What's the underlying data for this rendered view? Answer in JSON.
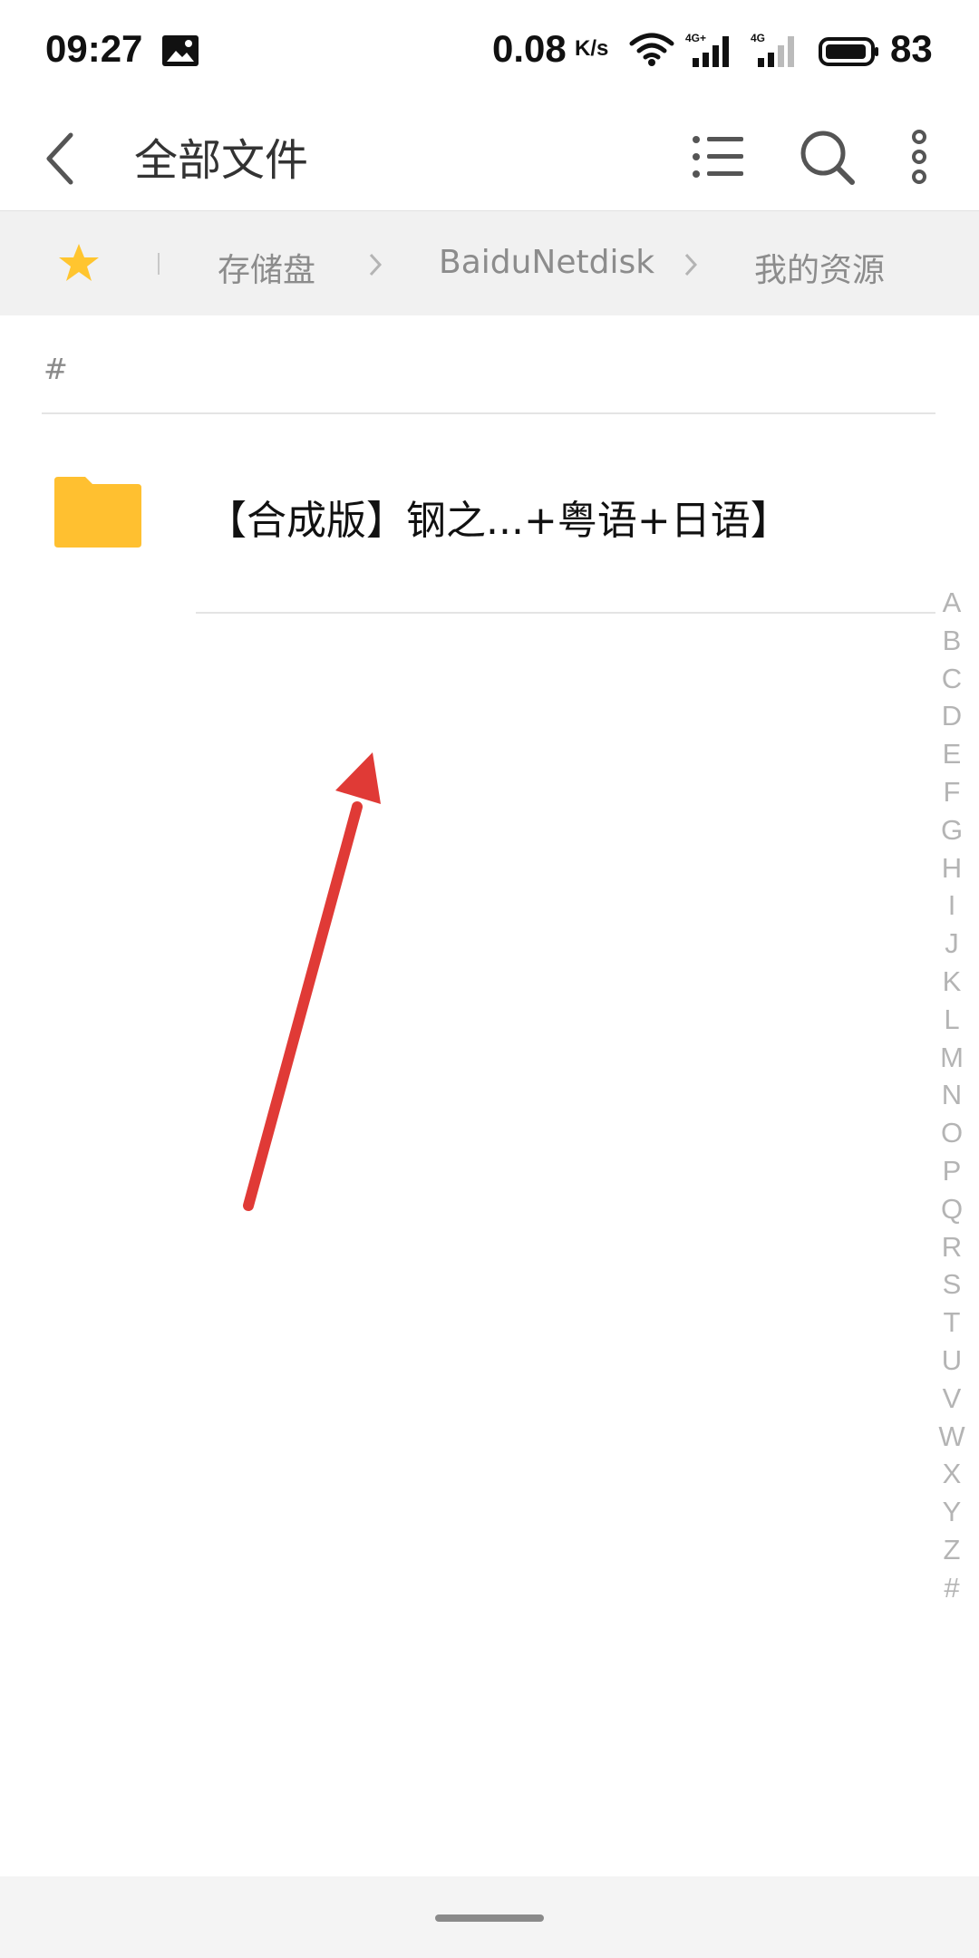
{
  "status_bar": {
    "time": "09:27",
    "net_speed": "0.08",
    "net_speed_unit": "K/s",
    "sim1_type": "4G+",
    "sim2_type": "4G",
    "battery": "83"
  },
  "app_bar": {
    "title": "全部文件",
    "icons": [
      "back-icon",
      "list-view-icon",
      "search-icon",
      "more-icon"
    ]
  },
  "breadcrumb": {
    "items": [
      "存储盘",
      "BaiduNetdisk",
      "我的资源"
    ],
    "star_color": "#FFC52F"
  },
  "section": {
    "header": "#"
  },
  "files": [
    {
      "name": "【合成版】钢之...+粤语+日语】",
      "type": "folder"
    }
  ],
  "alpha_index": [
    "A",
    "B",
    "C",
    "D",
    "E",
    "F",
    "G",
    "H",
    "I",
    "J",
    "K",
    "L",
    "M",
    "N",
    "O",
    "P",
    "Q",
    "R",
    "S",
    "T",
    "U",
    "V",
    "W",
    "X",
    "Y",
    "Z",
    "#"
  ],
  "colors": {
    "folder": "#FFC030",
    "arrow": "#E03A36",
    "breadcrumb_bg": "#F1F1F1"
  }
}
